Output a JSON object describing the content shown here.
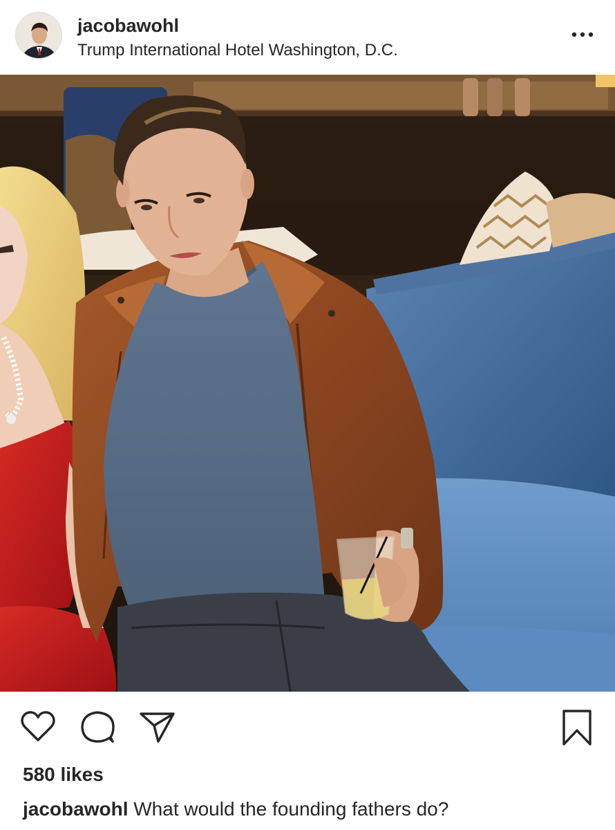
{
  "header": {
    "username": "jacobawohl",
    "location": "Trump International Hotel Washington, D.C.",
    "more_icon": "more-horizontal-icon"
  },
  "post": {
    "likes_text": "580 likes",
    "caption_user": "jacobawohl",
    "caption_text": "What would the founding fathers do?"
  },
  "actions": {
    "like_icon": "heart-outline-icon",
    "comment_icon": "comment-bubble-icon",
    "share_icon": "paper-plane-icon",
    "save_icon": "bookmark-outline-icon"
  },
  "colors": {
    "text": "#262626",
    "background": "#ffffff",
    "jacket": "#8b4a22",
    "sofa": "#3f6b9a",
    "dress": "#c0171c"
  }
}
